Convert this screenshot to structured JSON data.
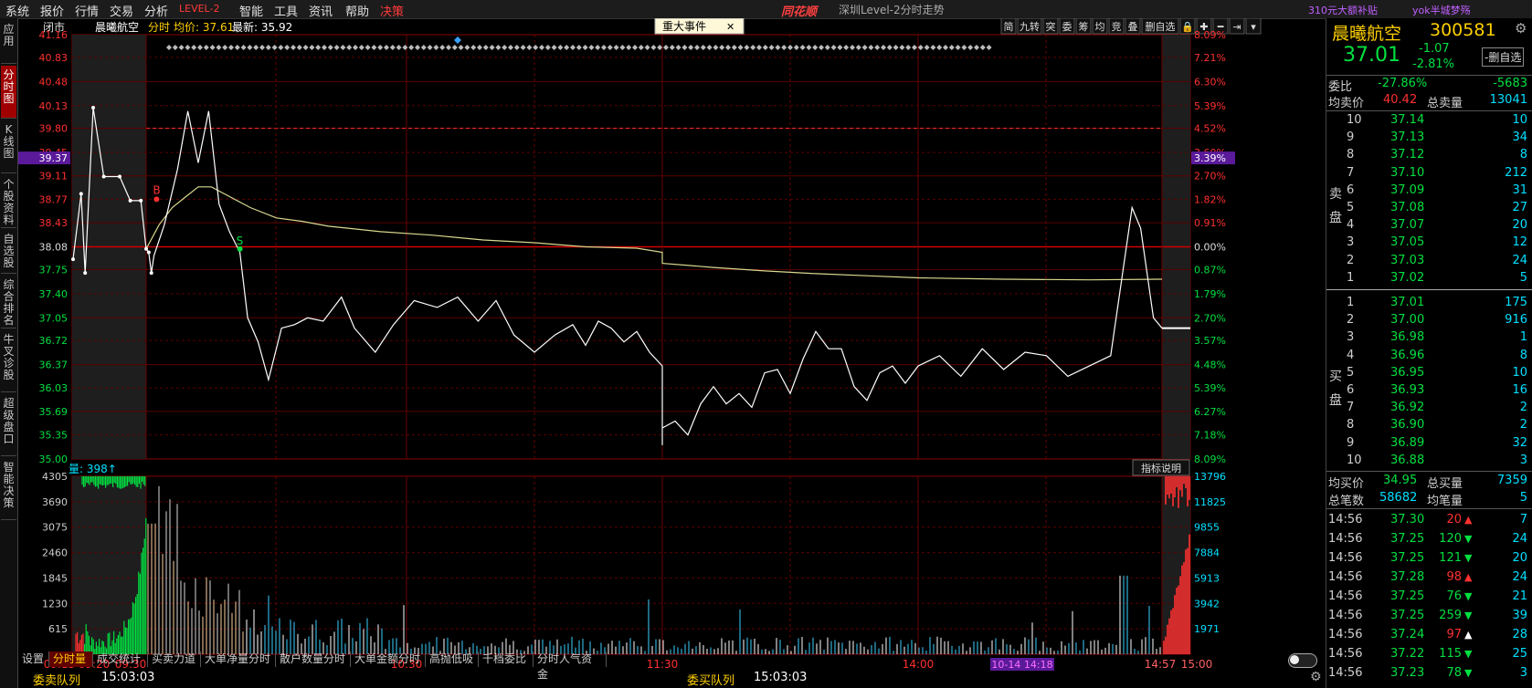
{
  "menu": {
    "items": [
      "系统",
      "报价",
      "行情",
      "交易",
      "分析",
      "LEVEL-2",
      "智能",
      "工具",
      "资讯",
      "帮助",
      "决策"
    ],
    "logo": "同花顺",
    "window_title": "深圳Level-2分时走势",
    "ad_text": "310元大额补贴",
    "user_text": "yok半城梦殇"
  },
  "left_nav": [
    "应用",
    "分时图",
    "K线图",
    "个股资料",
    "自选股",
    "综合排名",
    "牛叉诊股",
    "超级盘口",
    "智能决策"
  ],
  "chart_header": {
    "status": "闭市",
    "stock_name": "晨曦航空",
    "mode": "分时",
    "avg_label": "均价: 37.61",
    "last_label": "最新: 35.92",
    "event_button": "重大事件",
    "close_glyph": "✕",
    "toolbar": [
      "简",
      "九转",
      "突",
      "委",
      "筹",
      "均",
      "竞",
      "叠",
      "删自选",
      "🔒",
      "✚",
      "━",
      "⇥",
      "▾"
    ]
  },
  "axes": {
    "price_ticks": [
      "41.16",
      "40.83",
      "40.48",
      "40.13",
      "39.80",
      "39.45",
      "39.11",
      "38.77",
      "38.43",
      "38.08",
      "37.75",
      "37.40",
      "37.05",
      "36.72",
      "36.37",
      "36.03",
      "35.69",
      "35.35",
      "35.00"
    ],
    "pct_ticks": [
      "8.09%",
      "7.21%",
      "6.30%",
      "5.39%",
      "4.52%",
      "3.60%",
      "2.70%",
      "1.82%",
      "0.91%",
      "0.00%",
      "0.87%",
      "1.79%",
      "2.70%",
      "3.57%",
      "4.48%",
      "5.39%",
      "6.27%",
      "7.18%",
      "8.09%"
    ],
    "current_price_tag": "39.37",
    "current_pct_tag": "3.39%",
    "vol_ticks": [
      "4305",
      "3690",
      "3075",
      "2460",
      "1845",
      "1230",
      "615"
    ],
    "vol_right_ticks": [
      "13796",
      "11825",
      "9855",
      "7884",
      "5913",
      "3942",
      "1971"
    ],
    "time_labels": [
      "09:15",
      "09:20",
      "09:30",
      "10:30",
      "11:30",
      "14:00",
      "14:57",
      "15:00"
    ],
    "cursor_time": "10-14 14:18",
    "vol_label": "量: 398↑",
    "indicator_button": "指标说明",
    "buy_marker": "B",
    "sell_marker": "S"
  },
  "chart_data": {
    "type": "line",
    "prev_close": 38.08,
    "ylim": [
      35.0,
      41.16
    ],
    "price": [
      [
        9.15,
        37.9
      ],
      [
        9.17,
        38.85
      ],
      [
        9.18,
        37.7
      ],
      [
        9.2,
        40.1
      ],
      [
        9.22,
        39.1
      ],
      [
        9.25,
        39.1
      ],
      [
        9.27,
        38.75
      ],
      [
        9.29,
        38.75
      ],
      [
        9.3,
        38.05
      ],
      [
        9.31,
        38.0
      ],
      [
        9.32,
        37.7
      ],
      [
        9.33,
        37.95
      ],
      [
        9.37,
        38.4
      ],
      [
        9.42,
        39.2
      ],
      [
        9.46,
        40.05
      ],
      [
        9.5,
        39.3
      ],
      [
        9.54,
        40.05
      ],
      [
        9.58,
        38.7
      ],
      [
        9.62,
        38.3
      ],
      [
        9.66,
        38.0
      ],
      [
        9.69,
        37.05
      ],
      [
        9.73,
        36.7
      ],
      [
        9.77,
        36.15
      ],
      [
        9.82,
        36.9
      ],
      [
        9.87,
        36.95
      ],
      [
        9.92,
        37.05
      ],
      [
        9.98,
        37.0
      ],
      [
        10.05,
        37.35
      ],
      [
        10.1,
        36.9
      ],
      [
        10.18,
        36.55
      ],
      [
        10.25,
        36.95
      ],
      [
        10.33,
        37.3
      ],
      [
        10.42,
        37.2
      ],
      [
        10.5,
        37.35
      ],
      [
        10.58,
        37.0
      ],
      [
        10.65,
        37.3
      ],
      [
        10.72,
        36.8
      ],
      [
        10.8,
        36.55
      ],
      [
        10.88,
        36.8
      ],
      [
        10.95,
        36.95
      ],
      [
        11.0,
        36.65
      ],
      [
        11.05,
        37.0
      ],
      [
        11.1,
        36.9
      ],
      [
        11.15,
        36.7
      ],
      [
        11.2,
        36.85
      ],
      [
        11.25,
        36.55
      ],
      [
        11.3,
        36.35
      ],
      [
        11.35,
        36.15
      ],
      [
        11.4,
        36.3
      ],
      [
        11.45,
        36.25
      ],
      [
        11.5,
        36.35
      ],
      [
        11.55,
        36.2
      ],
      [
        11.6,
        36.0
      ],
      [
        11.65,
        35.85
      ],
      [
        11.7,
        35.95
      ],
      [
        11.75,
        36.1
      ],
      [
        11.8,
        35.7
      ],
      [
        11.85,
        35.5
      ],
      [
        11.9,
        35.2
      ],
      [
        11.95,
        35.5
      ],
      [
        13.0,
        35.45
      ],
      [
        13.05,
        35.55
      ],
      [
        13.1,
        35.35
      ],
      [
        13.15,
        35.8
      ],
      [
        13.2,
        36.05
      ],
      [
        13.25,
        35.8
      ],
      [
        13.3,
        35.95
      ],
      [
        13.35,
        35.75
      ],
      [
        13.4,
        36.25
      ],
      [
        13.45,
        36.3
      ],
      [
        13.5,
        35.95
      ],
      [
        13.55,
        36.45
      ],
      [
        13.6,
        36.85
      ],
      [
        13.65,
        36.6
      ],
      [
        13.7,
        36.6
      ],
      [
        13.75,
        36.05
      ],
      [
        13.8,
        35.85
      ],
      [
        13.85,
        36.25
      ],
      [
        13.9,
        36.35
      ],
      [
        13.95,
        36.1
      ],
      [
        14.0,
        36.35
      ],
      [
        14.05,
        36.5
      ],
      [
        14.1,
        36.2
      ],
      [
        14.15,
        36.6
      ],
      [
        14.2,
        36.3
      ],
      [
        14.25,
        36.55
      ],
      [
        14.3,
        36.5
      ],
      [
        14.35,
        36.2
      ],
      [
        14.4,
        36.35
      ],
      [
        14.45,
        36.5
      ],
      [
        14.5,
        38.65
      ],
      [
        14.52,
        38.35
      ],
      [
        14.55,
        37.05
      ],
      [
        14.57,
        36.9
      ]
    ],
    "avg": [
      [
        9.3,
        38.05
      ],
      [
        9.35,
        38.4
      ],
      [
        9.4,
        38.65
      ],
      [
        9.45,
        38.8
      ],
      [
        9.5,
        38.95
      ],
      [
        9.55,
        38.95
      ],
      [
        9.6,
        38.85
      ],
      [
        9.7,
        38.65
      ],
      [
        9.8,
        38.5
      ],
      [
        9.9,
        38.45
      ],
      [
        10.0,
        38.38
      ],
      [
        10.2,
        38.3
      ],
      [
        10.4,
        38.25
      ],
      [
        10.6,
        38.18
      ],
      [
        10.8,
        38.14
      ],
      [
        11.0,
        38.08
      ],
      [
        11.2,
        38.06
      ],
      [
        11.4,
        38.0
      ],
      [
        11.6,
        37.96
      ],
      [
        11.8,
        37.9
      ],
      [
        13.0,
        37.84
      ],
      [
        13.2,
        37.78
      ],
      [
        13.4,
        37.73
      ],
      [
        13.6,
        37.69
      ],
      [
        13.8,
        37.66
      ],
      [
        14.0,
        37.63
      ],
      [
        14.2,
        37.61
      ],
      [
        14.4,
        37.6
      ],
      [
        14.57,
        37.61
      ]
    ],
    "volume_scale_max": 4305
  },
  "quote": {
    "name": "晨曦航空",
    "code": "300581",
    "price": "37.01",
    "change": "-1.07",
    "change_pct": "-2.81%",
    "remove_button": "-删自选",
    "weibi_label": "委比",
    "weibi_pct": "-27.86%",
    "weibi_diff": "-5683",
    "avg_sell_label": "均卖价",
    "avg_sell": "40.42",
    "total_sell_label": "总卖量",
    "total_sell": "13041",
    "sell_side_label": "卖盘",
    "buy_side_label": "买盘",
    "sells": [
      [
        "10",
        "37.14",
        "10"
      ],
      [
        "9",
        "37.13",
        "34"
      ],
      [
        "8",
        "37.12",
        "8"
      ],
      [
        "7",
        "37.10",
        "212"
      ],
      [
        "6",
        "37.09",
        "31"
      ],
      [
        "5",
        "37.08",
        "27"
      ],
      [
        "4",
        "37.07",
        "20"
      ],
      [
        "3",
        "37.05",
        "12"
      ],
      [
        "2",
        "37.03",
        "24"
      ],
      [
        "1",
        "37.02",
        "5"
      ]
    ],
    "buys": [
      [
        "1",
        "37.01",
        "175"
      ],
      [
        "2",
        "37.00",
        "916"
      ],
      [
        "3",
        "36.98",
        "1"
      ],
      [
        "4",
        "36.96",
        "8"
      ],
      [
        "5",
        "36.95",
        "10"
      ],
      [
        "6",
        "36.93",
        "16"
      ],
      [
        "7",
        "36.92",
        "2"
      ],
      [
        "8",
        "36.90",
        "2"
      ],
      [
        "9",
        "36.89",
        "32"
      ],
      [
        "10",
        "36.88",
        "3"
      ]
    ],
    "avg_buy_label": "均买价",
    "avg_buy": "34.95",
    "total_buy_label": "总买量",
    "total_buy": "7359",
    "total_trades_label": "总笔数",
    "total_trades": "58682",
    "avg_vol_label": "均笔量",
    "avg_vol": "5",
    "ticks": [
      [
        "14:56",
        "37.30",
        "20",
        "up",
        "7"
      ],
      [
        "14:56",
        "37.25",
        "120",
        "down",
        "24"
      ],
      [
        "14:56",
        "37.25",
        "121",
        "down",
        "20"
      ],
      [
        "14:56",
        "37.28",
        "98",
        "up",
        "24"
      ],
      [
        "14:56",
        "37.25",
        "76",
        "down",
        "21"
      ],
      [
        "14:56",
        "37.25",
        "259",
        "down",
        "39"
      ],
      [
        "14:56",
        "37.24",
        "97",
        "up",
        "28"
      ],
      [
        "14:56",
        "37.22",
        "115",
        "down",
        "25"
      ],
      [
        "14:56",
        "37.23",
        "78",
        "down",
        "3"
      ]
    ]
  },
  "bottom": {
    "tabs": [
      "设置",
      "分时量",
      "成交统计",
      "买卖力道",
      "大单净量分时",
      "散户数量分时",
      "大单金额分时",
      "高抛低吸",
      "千档委比",
      "分时人气资金"
    ],
    "selected_tab": "分时量",
    "sell_queue_label": "委卖队列",
    "sell_queue_time": "15:03:03",
    "buy_queue_label": "委买队列",
    "buy_queue_time": "15:03:03"
  },
  "colors": {
    "up": "#ff3030",
    "down": "#00e040",
    "price_line": "#ffffff",
    "avg_line": "#d8d890",
    "grid": "#7a0000",
    "accent": "#ffd000"
  }
}
